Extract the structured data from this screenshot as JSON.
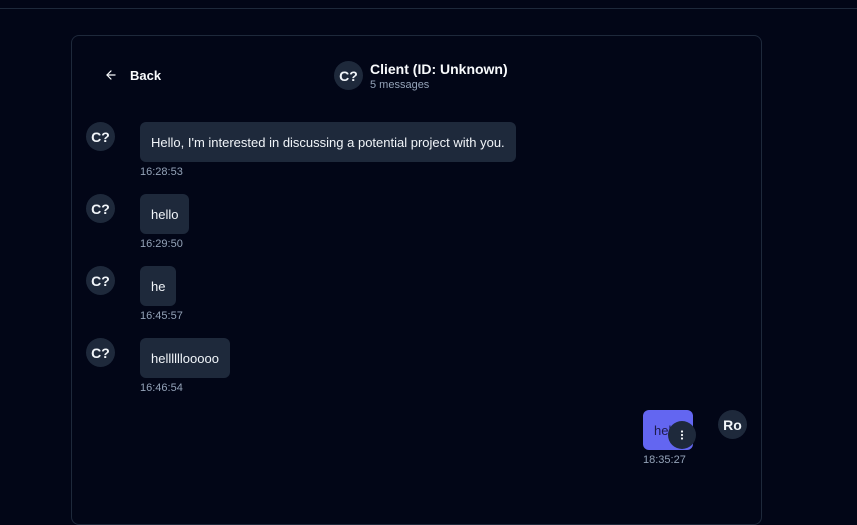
{
  "nav": {
    "back_label": "Back"
  },
  "header": {
    "avatar_initials": "C?",
    "title": "Client (ID: Unknown)",
    "subtitle": "5 messages"
  },
  "messages": [
    {
      "avatar": "C?",
      "text": "Hello, I'm interested in discussing a potential project with you.",
      "time": "16:28:53",
      "sender": "client"
    },
    {
      "avatar": "C?",
      "text": "hello",
      "time": "16:29:50",
      "sender": "client"
    },
    {
      "avatar": "C?",
      "text": "he",
      "time": "16:45:57",
      "sender": "client"
    },
    {
      "avatar": "C?",
      "text": "hellllllooooo",
      "time": "16:46:54",
      "sender": "client"
    },
    {
      "avatar": "Ro",
      "text": "hello",
      "time": "18:35:27",
      "sender": "me"
    }
  ],
  "icons": {
    "back": "arrow-left-icon",
    "message_menu": "more-vertical-icon"
  },
  "colors": {
    "background": "#020617",
    "bubble_client": "#1e293b",
    "bubble_me": "#6366f1",
    "muted_text": "#94a3b8"
  }
}
